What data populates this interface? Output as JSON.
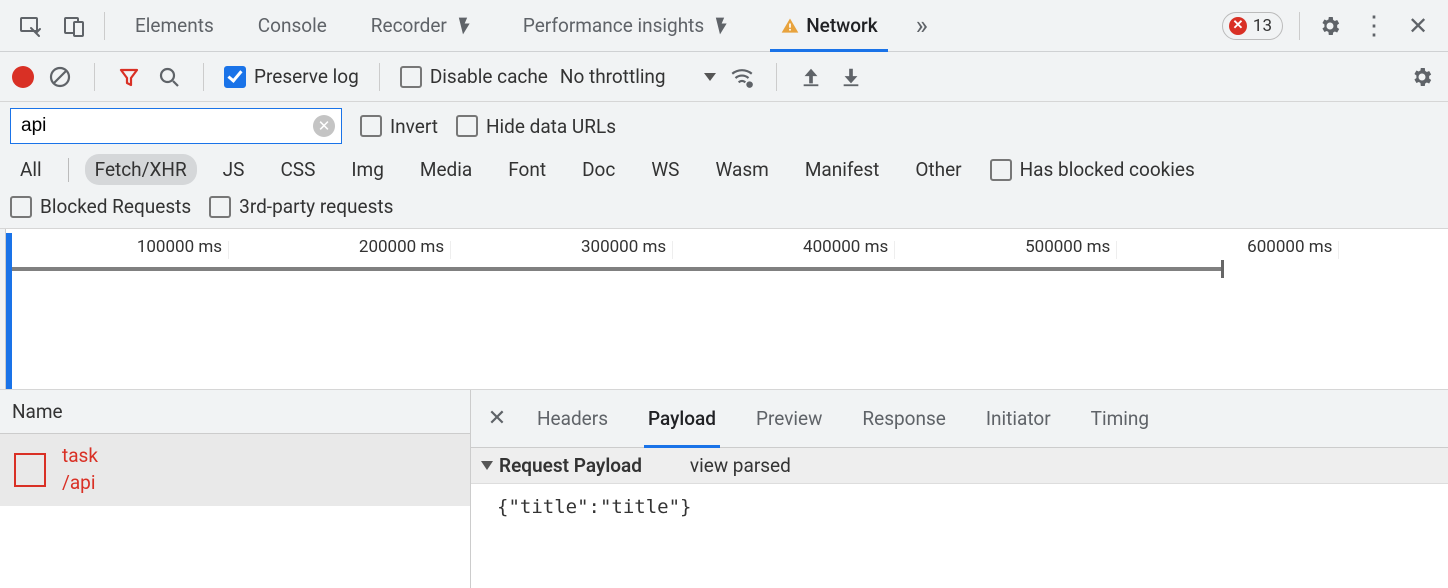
{
  "tabbar": {
    "tabs": {
      "elements": "Elements",
      "console": "Console",
      "recorder": "Recorder",
      "perf": "Performance insights",
      "network": "Network"
    },
    "error_count": "13"
  },
  "toolbar": {
    "preserve_log": "Preserve log",
    "disable_cache": "Disable cache",
    "throttling": "No throttling"
  },
  "filter": {
    "query": "api",
    "invert": "Invert",
    "hide_data_urls": "Hide data URLs",
    "types": {
      "all": "All",
      "fetch": "Fetch/XHR",
      "js": "JS",
      "css": "CSS",
      "img": "Img",
      "media": "Media",
      "font": "Font",
      "doc": "Doc",
      "ws": "WS",
      "wasm": "Wasm",
      "manifest": "Manifest",
      "other": "Other"
    },
    "has_blocked_cookies": "Has blocked cookies",
    "blocked_requests": "Blocked Requests",
    "third_party": "3rd-party requests"
  },
  "timeline": {
    "ticks": [
      "100000 ms",
      "200000 ms",
      "300000 ms",
      "400000 ms",
      "500000 ms",
      "600000 ms"
    ]
  },
  "requests": {
    "column_name": "Name",
    "items": [
      {
        "name": "task",
        "path": "/api"
      }
    ]
  },
  "detail": {
    "tabs": {
      "headers": "Headers",
      "payload": "Payload",
      "preview": "Preview",
      "response": "Response",
      "initiator": "Initiator",
      "timing": "Timing"
    },
    "payload": {
      "section": "Request Payload",
      "view_parsed": "view parsed",
      "body": "{\"title\":\"title\"}"
    }
  }
}
